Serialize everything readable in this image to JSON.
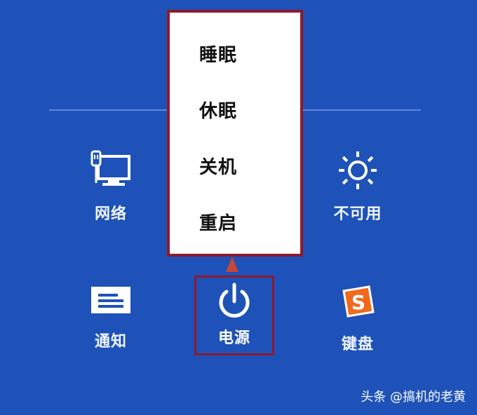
{
  "menu": {
    "items": [
      {
        "label": "睡眠"
      },
      {
        "label": "休眠"
      },
      {
        "label": "关机"
      },
      {
        "label": "重启"
      }
    ]
  },
  "tiles": {
    "network": {
      "label": "网络",
      "icon": "network-icon"
    },
    "unavailable": {
      "label": "不可用",
      "icon": "brightness-icon"
    },
    "notifications": {
      "label": "通知",
      "icon": "notifications-icon"
    },
    "power": {
      "label": "电源",
      "icon": "power-icon"
    },
    "keyboard": {
      "label": "键盘",
      "icon": "keyboard-icon"
    }
  },
  "watermark": "头条 @搞机的老黄",
  "colors": {
    "background": "#1e52b8",
    "highlight_border": "#8e1a2c",
    "menu_background": "#ffffff",
    "keyboard_icon": "#f06a1e"
  }
}
